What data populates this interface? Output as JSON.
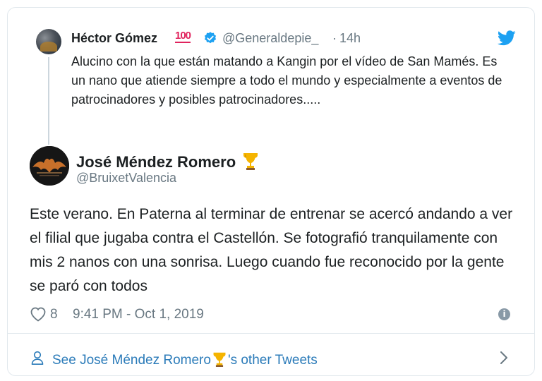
{
  "parent_tweet": {
    "author_name": "Héctor Gómez",
    "emoji": "100",
    "handle": "@Generaldepie_",
    "separator": "·",
    "time": "14h",
    "text": "Alucino con la que están matando a Kangin por el vídeo de San Mamés. Es un nano que atiende siempre a todo el mundo y especialmente a eventos de patrocinadores y posibles patrocinadores....."
  },
  "tweet": {
    "author_name": "José Méndez Romero",
    "handle": "@BruixetValencia",
    "text": "Este verano. En Paterna al terminar de entrenar se acercó andando a ver el filial que jugaba contra el Castellón. Se fotografió tranquilamente con mis 2 nanos con una sonrisa. Luego cuando fue reconocido por la gente se paró con todos",
    "likes": "8",
    "timestamp": "9:41 PM - Oct 1, 2019"
  },
  "footer": {
    "prefix": "See José Méndez Romero",
    "suffix": "'s other Tweets"
  },
  "icons": {
    "brand": "twitter-bird-icon",
    "verified": "verified-badge-icon",
    "like": "heart-icon",
    "info": "info-icon",
    "profile": "person-icon",
    "next": "chevron-right-icon",
    "name_emoji": "trophy-icon"
  },
  "colors": {
    "twitter_blue": "#1da1f2",
    "link_blue": "#2b7bb9",
    "muted": "#697882",
    "border": "#e1e8ed",
    "emoji_red": "#e0245e"
  }
}
